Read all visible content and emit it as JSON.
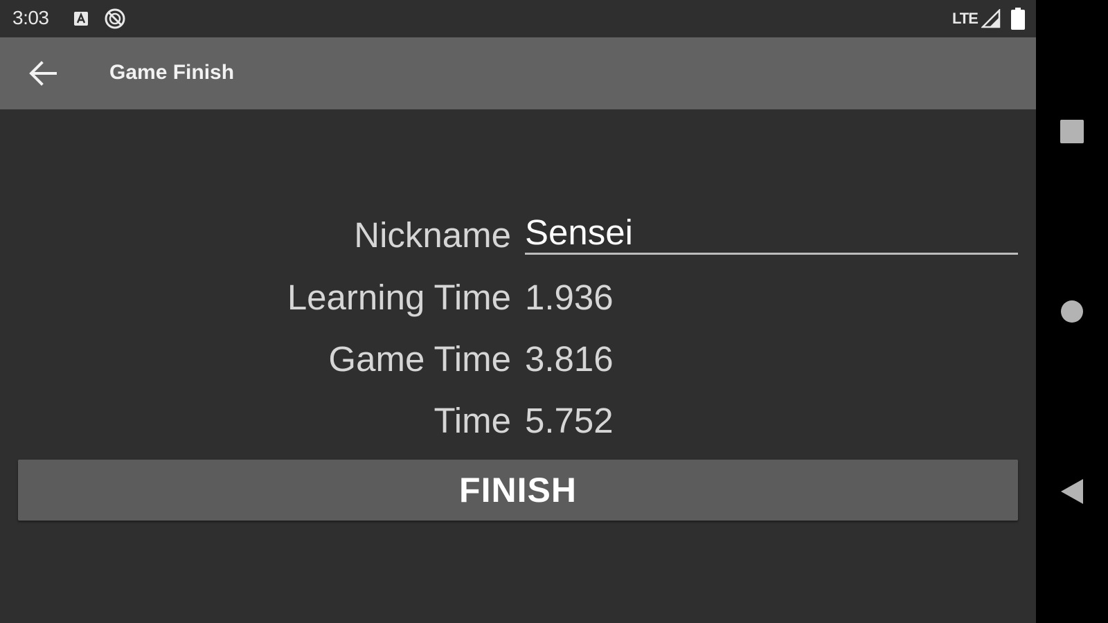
{
  "status_bar": {
    "time": "3:03",
    "network": "LTE",
    "icons": [
      "notification-a-icon",
      "do-not-disturb-icon",
      "signal-icon",
      "battery-icon"
    ]
  },
  "app_bar": {
    "title": "Game Finish",
    "back_icon": "arrow-left-icon"
  },
  "form": {
    "nickname_label": "Nickname",
    "nickname_value": "Sensei",
    "learning_time_label": "Learning Time",
    "learning_time_value": "1.936",
    "game_time_label": "Game Time",
    "game_time_value": "3.816",
    "time_label": "Time",
    "time_value": "5.752"
  },
  "finish_button": {
    "label": "FINISH"
  },
  "nav_bar": {
    "icons": [
      "recents-square-icon",
      "home-circle-icon",
      "back-triangle-icon"
    ]
  },
  "colors": {
    "background": "#2f2f2f",
    "app_bar": "#626262",
    "button": "#5c5c5c",
    "nav_bar": "#000000"
  }
}
